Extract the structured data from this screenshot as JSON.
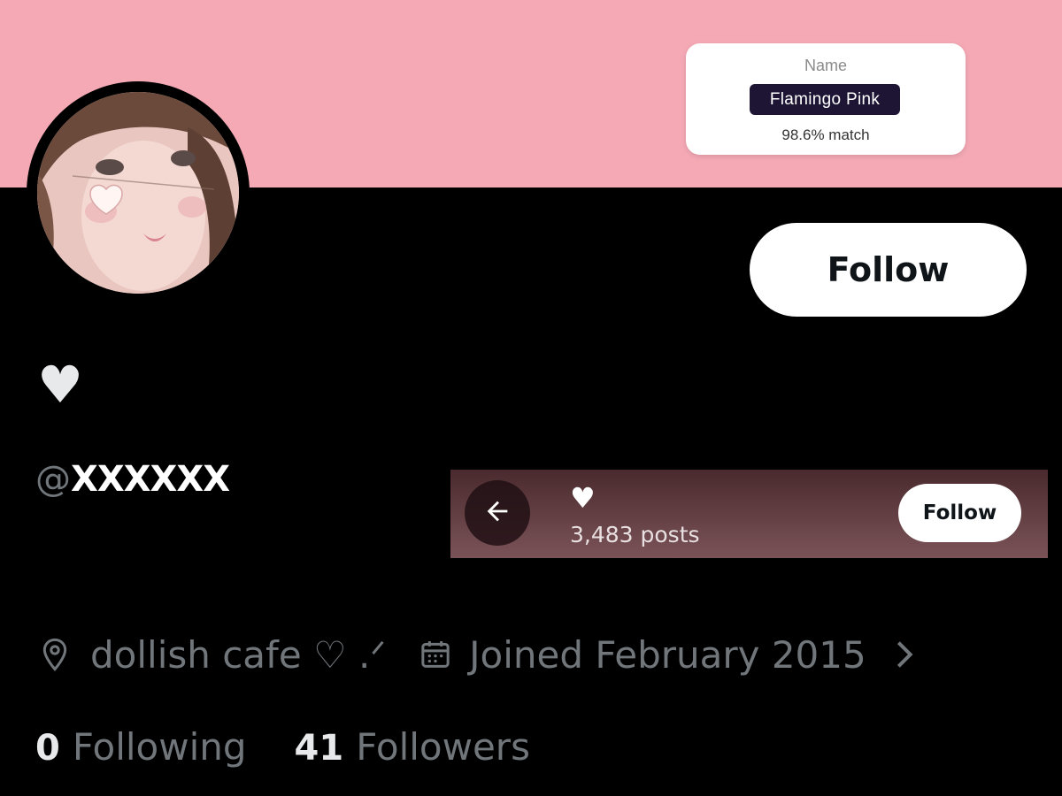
{
  "colors": {
    "banner": "#f4a9b5",
    "background": "#000000",
    "muted_text": "#71767b",
    "primary_text": "#e7e9ea",
    "sticky_bar_top": "#4a2a2e",
    "sticky_bar_bottom": "#7a5358",
    "name_pill": "#1d1533"
  },
  "color_card": {
    "label": "Name",
    "color_name": "Flamingo Pink",
    "match": "98.6% match"
  },
  "profile": {
    "display_name": "♥",
    "handle_prefix": "@",
    "handle_censored": "XXXXXX",
    "follow_label": "Follow",
    "location": "dollish cafe ♡ .ᐟ",
    "joined": "Joined February 2015"
  },
  "sticky_header": {
    "name": "♥",
    "posts": "3,483 posts",
    "follow_label": "Follow"
  },
  "stats": {
    "following_count": "0",
    "following_label": "Following",
    "followers_count": "41",
    "followers_label": "Followers"
  },
  "icons": {
    "back": "arrow-left-icon",
    "location": "map-pin-icon",
    "calendar": "calendar-icon",
    "chevron": "chevron-right-icon"
  }
}
